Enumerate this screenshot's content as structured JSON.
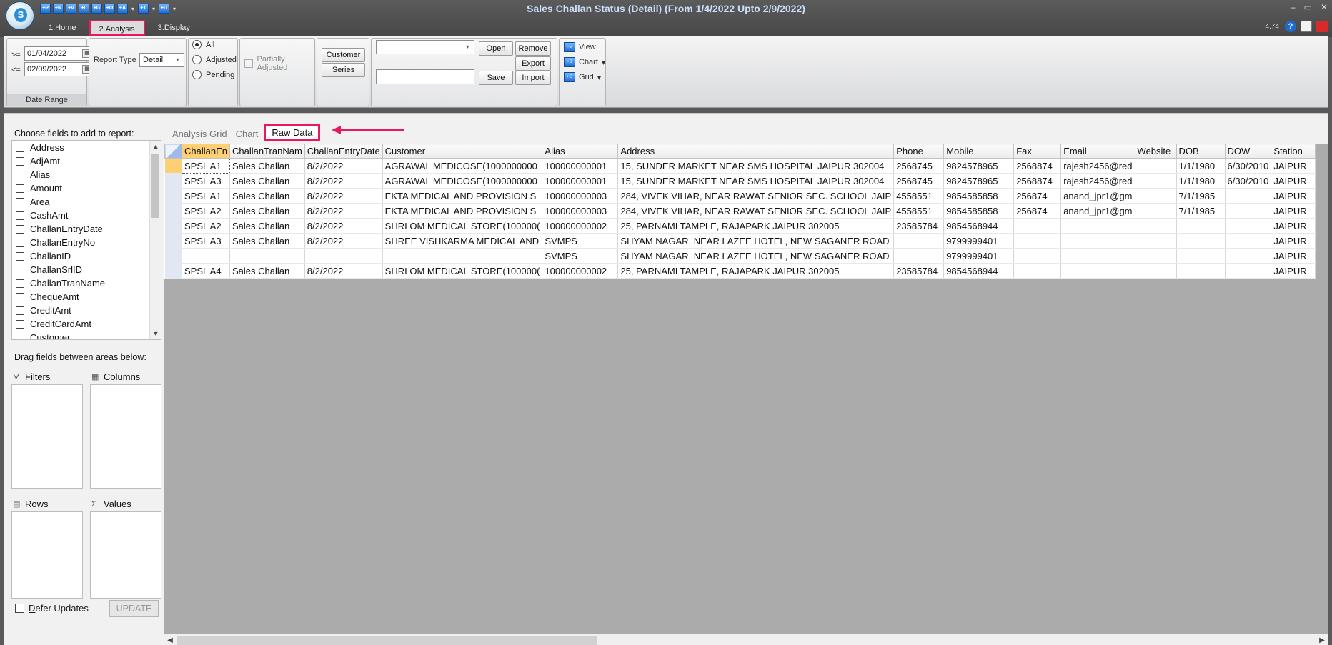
{
  "window": {
    "title": "Sales Challan Status (Detail)  (From 1/4/2022 Upto 2/9/2022)",
    "version": "4.74",
    "logo_letter": "S",
    "controls": [
      "–",
      "▭",
      "✕"
    ]
  },
  "quick_access": [
    "+P",
    "+N",
    "+V",
    "+L",
    "+G",
    "+O",
    "+A",
    "+T",
    "+U"
  ],
  "ribbon_tabs": [
    "1.Home",
    "2.Analysis",
    "3.Display"
  ],
  "active_ribbon_tab": "2.Analysis",
  "date_range": {
    "from_label": ">=",
    "from_value": "01/04/2022",
    "to_label": "<=",
    "to_value": "02/09/2022",
    "caption": "Date Range"
  },
  "report_type": {
    "label": "Report Type",
    "value": "Detail"
  },
  "filter_radios": [
    {
      "label": "All",
      "selected": true
    },
    {
      "label": "Adjusted",
      "selected": false
    },
    {
      "label": "Pending",
      "selected": false
    }
  ],
  "partially_adjusted": {
    "label": "Partially Adjusted",
    "checked": false
  },
  "buttons": {
    "customer": "Customer",
    "series": "Series",
    "open": "Open",
    "remove": "Remove",
    "export": "Export",
    "save": "Save",
    "import": "Import"
  },
  "view_menu": [
    "View",
    "Chart",
    "Grid"
  ],
  "field_panel": {
    "title": "Choose fields to add to report:",
    "fields": [
      "Address",
      "AdjAmt",
      "Alias",
      "Amount",
      "Area",
      "CashAmt",
      "ChallanEntryDate",
      "ChallanEntryNo",
      "ChallanID",
      "ChallanSrlID",
      "ChallanTranName",
      "ChequeAmt",
      "CreditAmt",
      "CreditCardAmt",
      "Customer"
    ],
    "drag_title": "Drag fields between areas below:",
    "areas": {
      "filters": "Filters",
      "columns": "Columns",
      "rows": "Rows",
      "values": "Values"
    },
    "defer_label_u": "D",
    "defer_label_rest": "efer Updates",
    "update_label": "UPDATE"
  },
  "data_tabs": [
    "Analysis Grid",
    "Chart",
    "Raw Data"
  ],
  "active_data_tab": "Raw Data",
  "grid": {
    "columns": [
      "ChallanEn",
      "ChallanTranNam",
      "ChallanEntryDate",
      "Customer",
      "Alias",
      "Address",
      "Phone",
      "Mobile",
      "Fax",
      "Email",
      "Website",
      "DOB",
      "DOW",
      "Station"
    ],
    "rows": [
      [
        "SPSL A1",
        "Sales Challan",
        "8/2/2022",
        "AGRAWAL MEDICOSE(1000000000",
        "100000000001",
        "15, SUNDER MARKET NEAR SMS HOSPITAL JAIPUR 302004",
        "2568745",
        "9824578965",
        "2568874",
        "rajesh2456@red",
        "",
        "1/1/1980",
        "6/30/2010",
        "JAIPUR"
      ],
      [
        "SPSL A3",
        "Sales Challan",
        "8/2/2022",
        "AGRAWAL MEDICOSE(1000000000",
        "100000000001",
        "15, SUNDER MARKET NEAR SMS HOSPITAL JAIPUR 302004",
        "2568745",
        "9824578965",
        "2568874",
        "rajesh2456@red",
        "",
        "1/1/1980",
        "6/30/2010",
        "JAIPUR"
      ],
      [
        "SPSL A1",
        "Sales Challan",
        "8/2/2022",
        "EKTA MEDICAL AND PROVISION S",
        "100000000003",
        "284, VIVEK VIHAR, NEAR RAWAT SENIOR  SEC. SCHOOL JAIP",
        "4558551",
        "9854585858",
        "256874",
        "anand_jpr1@gm",
        "",
        "7/1/1985",
        "",
        "JAIPUR"
      ],
      [
        "SPSL A2",
        "Sales Challan",
        "8/2/2022",
        "EKTA MEDICAL AND PROVISION S",
        "100000000003",
        "284, VIVEK VIHAR, NEAR RAWAT SENIOR  SEC. SCHOOL JAIP",
        "4558551",
        "9854585858",
        "256874",
        "anand_jpr1@gm",
        "",
        "7/1/1985",
        "",
        "JAIPUR"
      ],
      [
        "SPSL A2",
        "Sales Challan",
        "8/2/2022",
        "SHRI OM MEDICAL STORE(100000(",
        "100000000002",
        "25, PARNAMI TAMPLE, RAJAPARK JAIPUR 302005",
        "23585784",
        "9854568944",
        "",
        "",
        "",
        "",
        "",
        "JAIPUR"
      ],
      [
        "SPSL A3",
        "Sales Challan",
        "8/2/2022",
        "SHREE VISHKARMA MEDICAL AND",
        "SVMPS",
        "SHYAM NAGAR, NEAR LAZEE HOTEL, NEW SAGANER ROAD",
        "",
        "9799999401",
        "",
        "",
        "",
        "",
        "",
        "JAIPUR"
      ],
      [
        "",
        "",
        "",
        "",
        "SVMPS",
        "SHYAM NAGAR, NEAR LAZEE HOTEL, NEW SAGANER ROAD",
        "",
        "9799999401",
        "",
        "",
        "",
        "",
        "",
        "JAIPUR"
      ],
      [
        "SPSL A4",
        "Sales Challan",
        "8/2/2022",
        "SHRI OM MEDICAL STORE(100000(",
        "100000000002",
        "25, PARNAMI TAMPLE, RAJAPARK JAIPUR 302005",
        "23585784",
        "9854568944",
        "",
        "",
        "",
        "",
        "",
        "JAIPUR"
      ]
    ]
  },
  "colors": {
    "highlight": "#e8195f",
    "selected_header": "#ffcf73",
    "grid_bg": "#ababab"
  }
}
